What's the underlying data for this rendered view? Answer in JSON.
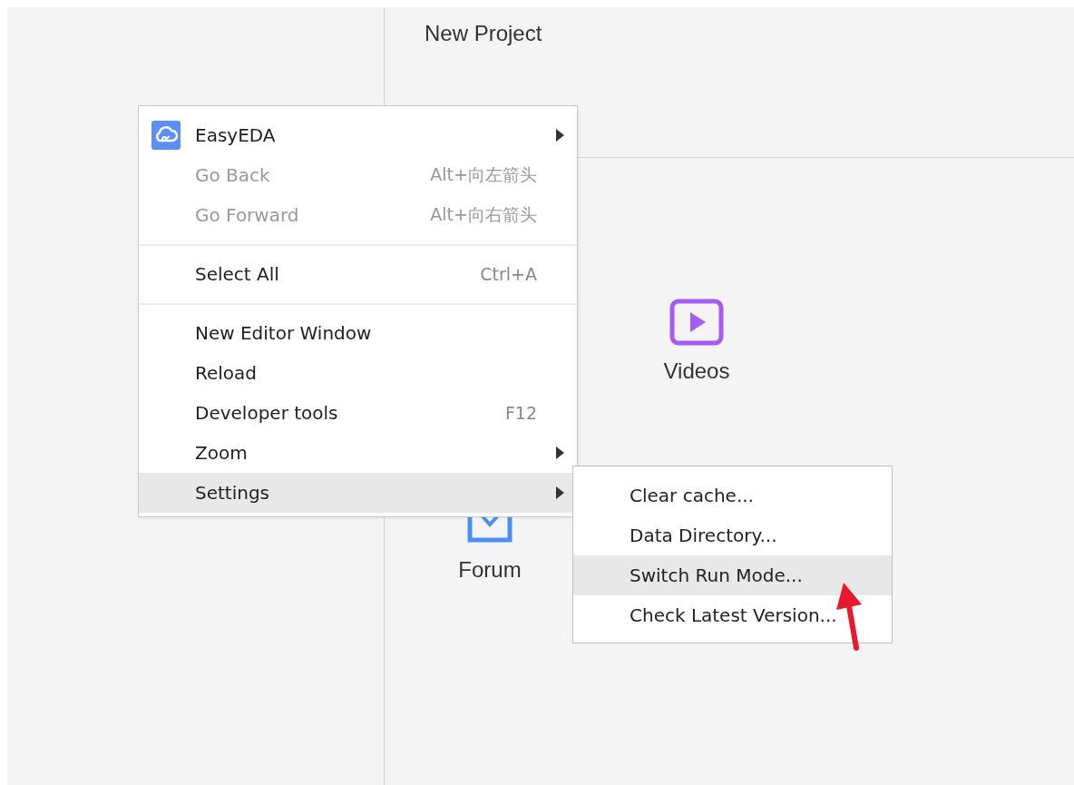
{
  "page": {
    "title": "New Project"
  },
  "tiles": [
    {
      "label": "Videos",
      "kind": "video"
    },
    {
      "label": "Forum",
      "kind": "forum"
    }
  ],
  "context_menu": {
    "items": [
      {
        "kind": "item",
        "label": "EasyEDA",
        "icon": true,
        "submenu": true,
        "disabled": false,
        "selected": false
      },
      {
        "kind": "item",
        "label": "Go Back",
        "shortcut": "Alt+向左箭头",
        "submenu": false,
        "disabled": true,
        "selected": false
      },
      {
        "kind": "item",
        "label": "Go Forward",
        "shortcut": "Alt+向右箭头",
        "submenu": false,
        "disabled": true,
        "selected": false
      },
      {
        "kind": "separator"
      },
      {
        "kind": "item",
        "label": "Select All",
        "shortcut": "Ctrl+A",
        "submenu": false,
        "disabled": false,
        "selected": false
      },
      {
        "kind": "separator"
      },
      {
        "kind": "item",
        "label": "New Editor Window",
        "submenu": false,
        "disabled": false,
        "selected": false
      },
      {
        "kind": "item",
        "label": "Reload",
        "submenu": false,
        "disabled": false,
        "selected": false
      },
      {
        "kind": "item",
        "label": "Developer tools",
        "shortcut": "F12",
        "submenu": false,
        "disabled": false,
        "selected": false
      },
      {
        "kind": "item",
        "label": "Zoom",
        "submenu": true,
        "disabled": false,
        "selected": false
      },
      {
        "kind": "item",
        "label": "Settings",
        "submenu": true,
        "disabled": false,
        "selected": true
      }
    ]
  },
  "settings_submenu": {
    "items": [
      {
        "label": "Clear cache...",
        "selected": false
      },
      {
        "label": "Data Directory...",
        "selected": false
      },
      {
        "label": "Switch Run Mode...",
        "selected": true
      },
      {
        "label": "Check Latest Version...",
        "selected": false
      }
    ]
  }
}
